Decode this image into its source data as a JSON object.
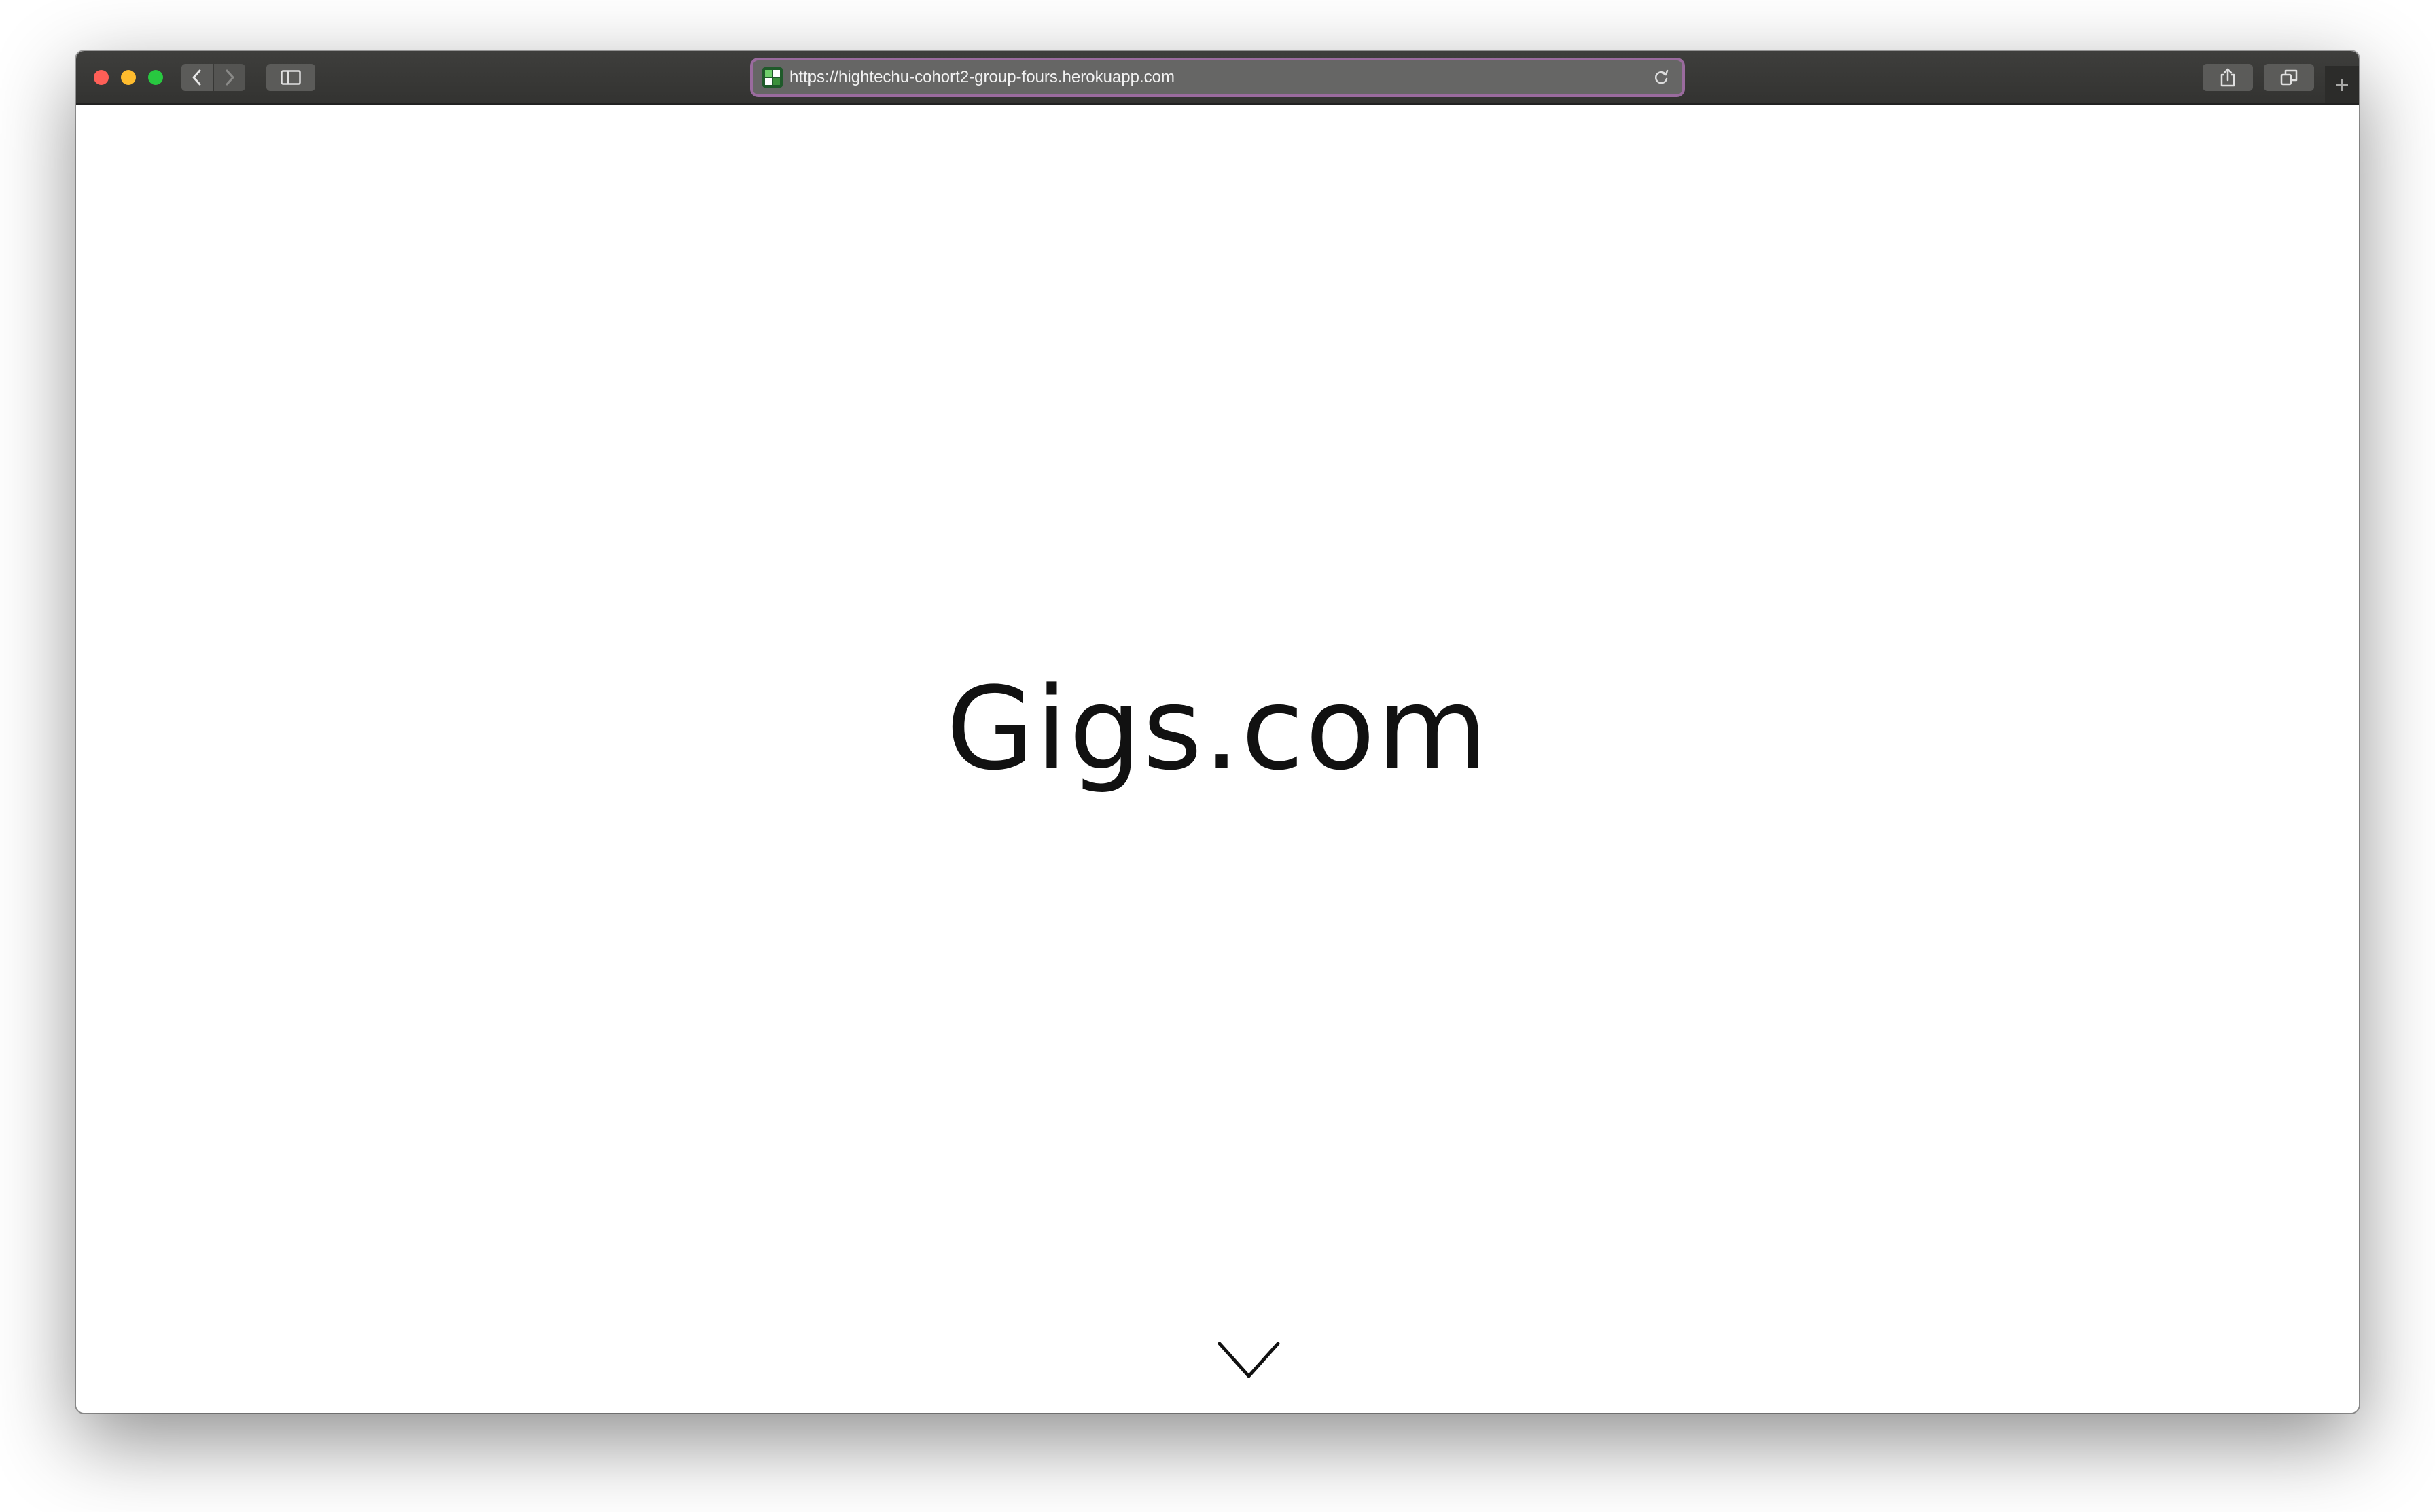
{
  "browser": {
    "address_bar": {
      "url": "https://hightechu-cohort2-group-fours.herokuapp.com"
    },
    "icons": {
      "back": "chevron-left-icon",
      "forward": "chevron-right-icon",
      "sidebar": "sidebar-icon",
      "reload": "reload-icon",
      "share": "share-icon",
      "tabs": "tab-overview-icon",
      "new_tab": "plus-icon"
    },
    "colors": {
      "close": "#fe5f57",
      "minimize": "#febc2e",
      "maximize": "#28c840",
      "address_focus_ring": "#9a6b9e"
    }
  },
  "page": {
    "title": "Gigs.com",
    "scroll_indicator": "chevron-down-icon"
  }
}
